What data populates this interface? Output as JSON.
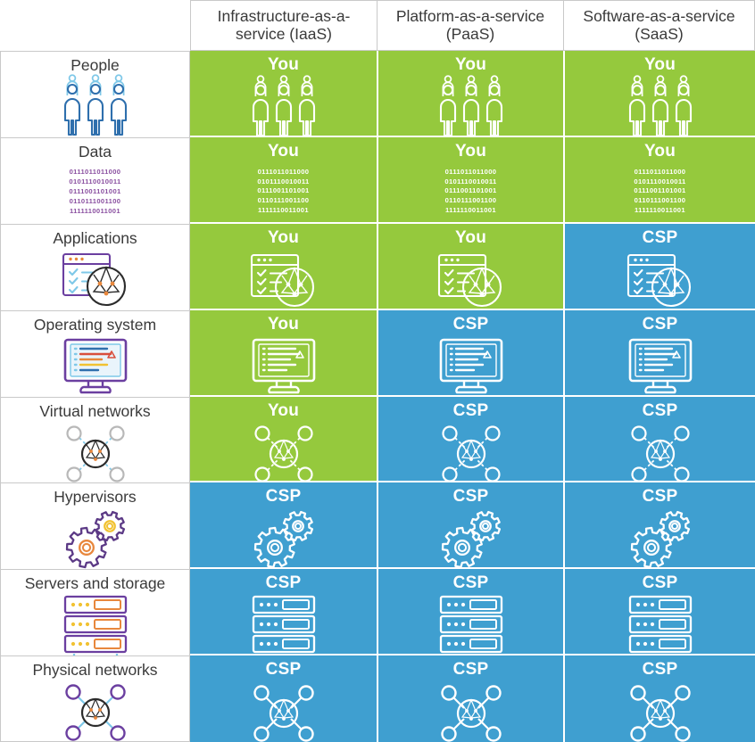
{
  "colors": {
    "you_cell": "#95c93d",
    "csp_cell": "#3f9fd0",
    "grid_line": "#c9c9c9",
    "label_text": "#3a3a3a",
    "value_text": "#ffffff",
    "binary_purple": "#8a4fa0"
  },
  "header": {
    "corner_label": "",
    "columns": [
      {
        "label": "Infrastructure-as-a-service (IaaS)",
        "short": "IaaS"
      },
      {
        "label": "Platform-as-a-service (PaaS)",
        "short": "PaaS"
      },
      {
        "label": "Software-as-a-service (SaaS)",
        "short": "SaaS"
      }
    ]
  },
  "legend": {
    "you": "You",
    "csp": "CSP"
  },
  "binary_lines": "0111011011000\n0101110010011\n0111001101001\n0110111001100\n1111110011001",
  "rows": [
    {
      "label": "People",
      "icon": "people-icon",
      "cells": [
        {
          "value": "You",
          "owner": "you",
          "icon": "people-icon"
        },
        {
          "value": "You",
          "owner": "you",
          "icon": "people-icon"
        },
        {
          "value": "You",
          "owner": "you",
          "icon": "people-icon"
        }
      ]
    },
    {
      "label": "Data",
      "icon": "binary-data-icon",
      "cells": [
        {
          "value": "You",
          "owner": "you",
          "icon": "binary-data-icon"
        },
        {
          "value": "You",
          "owner": "you",
          "icon": "binary-data-icon"
        },
        {
          "value": "You",
          "owner": "you",
          "icon": "binary-data-icon"
        }
      ]
    },
    {
      "label": "Applications",
      "icon": "applications-icon",
      "cells": [
        {
          "value": "You",
          "owner": "you",
          "icon": "applications-icon"
        },
        {
          "value": "You",
          "owner": "you",
          "icon": "applications-icon"
        },
        {
          "value": "CSP",
          "owner": "csp",
          "icon": "applications-icon"
        }
      ]
    },
    {
      "label": "Operating system",
      "icon": "monitor-icon",
      "cells": [
        {
          "value": "You",
          "owner": "you",
          "icon": "monitor-icon"
        },
        {
          "value": "CSP",
          "owner": "csp",
          "icon": "monitor-icon"
        },
        {
          "value": "CSP",
          "owner": "csp",
          "icon": "monitor-icon"
        }
      ]
    },
    {
      "label": "Virtual networks",
      "icon": "virtual-network-icon",
      "cells": [
        {
          "value": "You",
          "owner": "you",
          "icon": "virtual-network-icon"
        },
        {
          "value": "CSP",
          "owner": "csp",
          "icon": "virtual-network-icon"
        },
        {
          "value": "CSP",
          "owner": "csp",
          "icon": "virtual-network-icon"
        }
      ]
    },
    {
      "label": "Hypervisors",
      "icon": "gears-icon",
      "cells": [
        {
          "value": "CSP",
          "owner": "csp",
          "icon": "gears-icon"
        },
        {
          "value": "CSP",
          "owner": "csp",
          "icon": "gears-icon"
        },
        {
          "value": "CSP",
          "owner": "csp",
          "icon": "gears-icon"
        }
      ]
    },
    {
      "label": "Servers and storage",
      "icon": "server-rack-icon",
      "cells": [
        {
          "value": "CSP",
          "owner": "csp",
          "icon": "server-rack-icon"
        },
        {
          "value": "CSP",
          "owner": "csp",
          "icon": "server-rack-icon"
        },
        {
          "value": "CSP",
          "owner": "csp",
          "icon": "server-rack-icon"
        }
      ]
    },
    {
      "label": "Physical networks",
      "icon": "physical-network-icon",
      "cells": [
        {
          "value": "CSP",
          "owner": "csp",
          "icon": "physical-network-icon"
        },
        {
          "value": "CSP",
          "owner": "csp",
          "icon": "physical-network-icon"
        },
        {
          "value": "CSP",
          "owner": "csp",
          "icon": "physical-network-icon"
        }
      ]
    }
  ]
}
